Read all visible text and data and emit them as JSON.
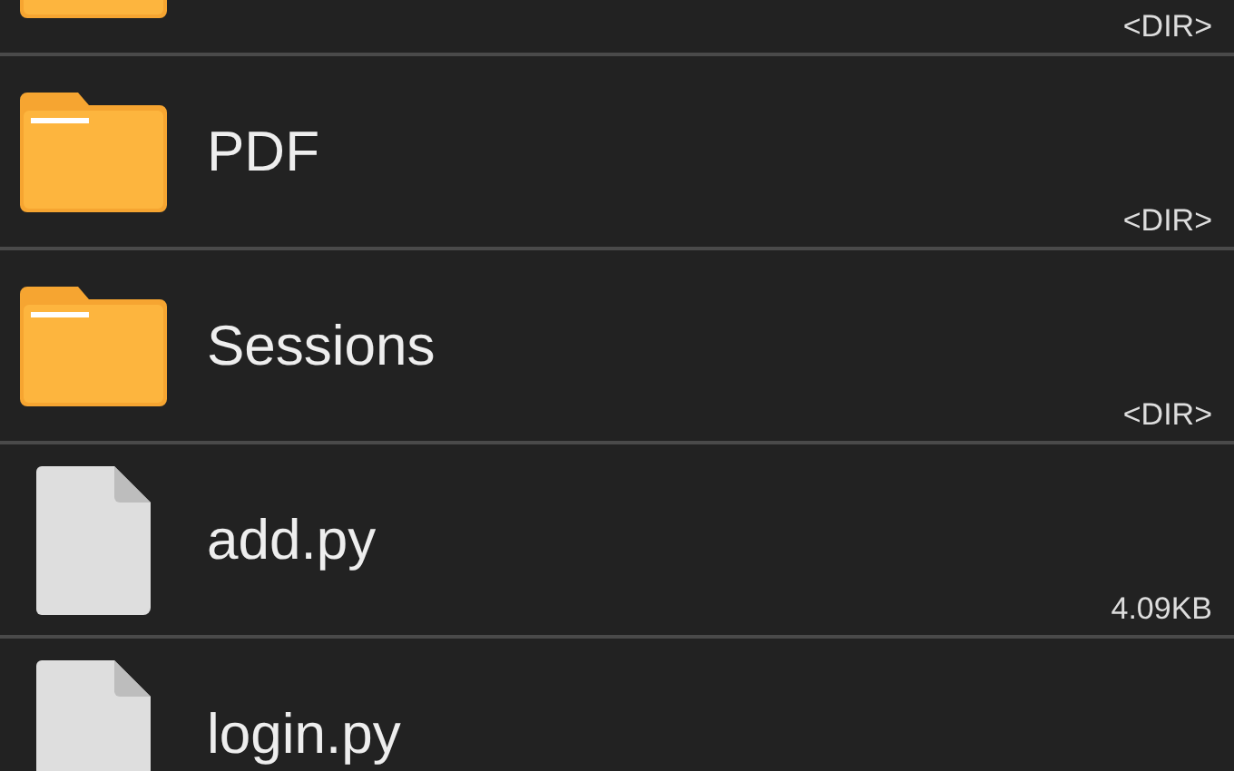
{
  "files": [
    {
      "kind": "folder",
      "size": "<DIR>"
    },
    {
      "kind": "folder",
      "name": "PDF",
      "size": "<DIR>"
    },
    {
      "kind": "folder",
      "name": "Sessions",
      "size": "<DIR>"
    },
    {
      "kind": "file",
      "name": "add.py",
      "size": "4.09KB"
    },
    {
      "kind": "file",
      "name": "login.py"
    }
  ]
}
